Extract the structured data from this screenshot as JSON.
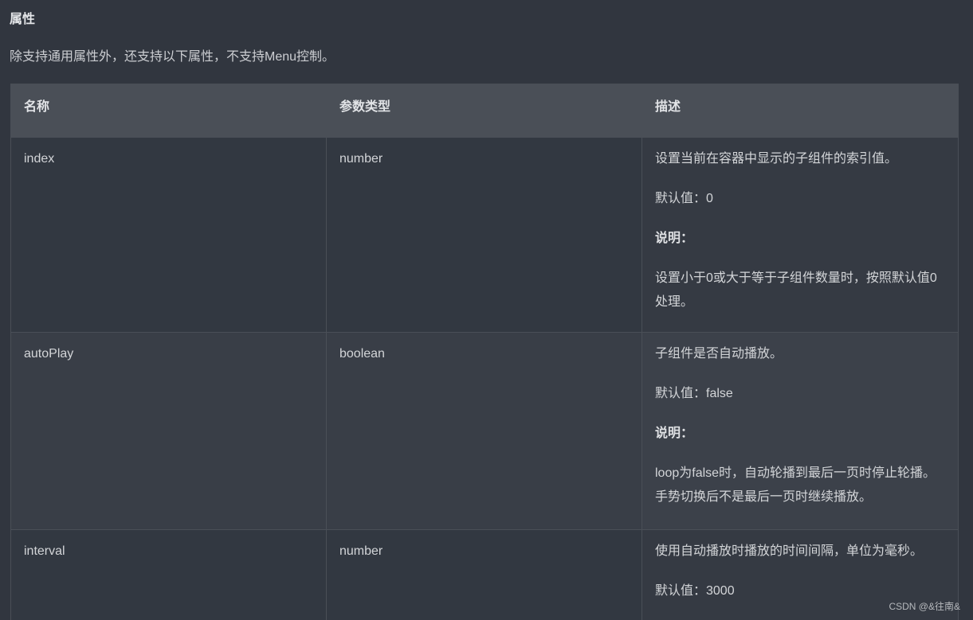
{
  "section": {
    "title": "属性",
    "intro": "除支持通用属性外，还支持以下属性，不支持Menu控制。"
  },
  "table": {
    "headers": [
      "名称",
      "参数类型",
      "描述"
    ],
    "rows": [
      {
        "name": "index",
        "type": "number",
        "desc": {
          "summary": "设置当前在容器中显示的子组件的索引值。",
          "default": "默认值：0",
          "note_label": "说明：",
          "note": "设置小于0或大于等于子组件数量时，按照默认值0处理。"
        }
      },
      {
        "name": "autoPlay",
        "type": "boolean",
        "desc": {
          "summary": "子组件是否自动播放。",
          "default": "默认值：false",
          "note_label": "说明：",
          "note": "loop为false时，自动轮播到最后一页时停止轮播。手势切换后不是最后一页时继续播放。"
        }
      },
      {
        "name": "interval",
        "type": "number",
        "desc": {
          "summary": "使用自动播放时播放的时间间隔，单位为毫秒。",
          "default": "默认值：3000"
        }
      }
    ]
  },
  "watermark": "CSDN @&往南&"
}
